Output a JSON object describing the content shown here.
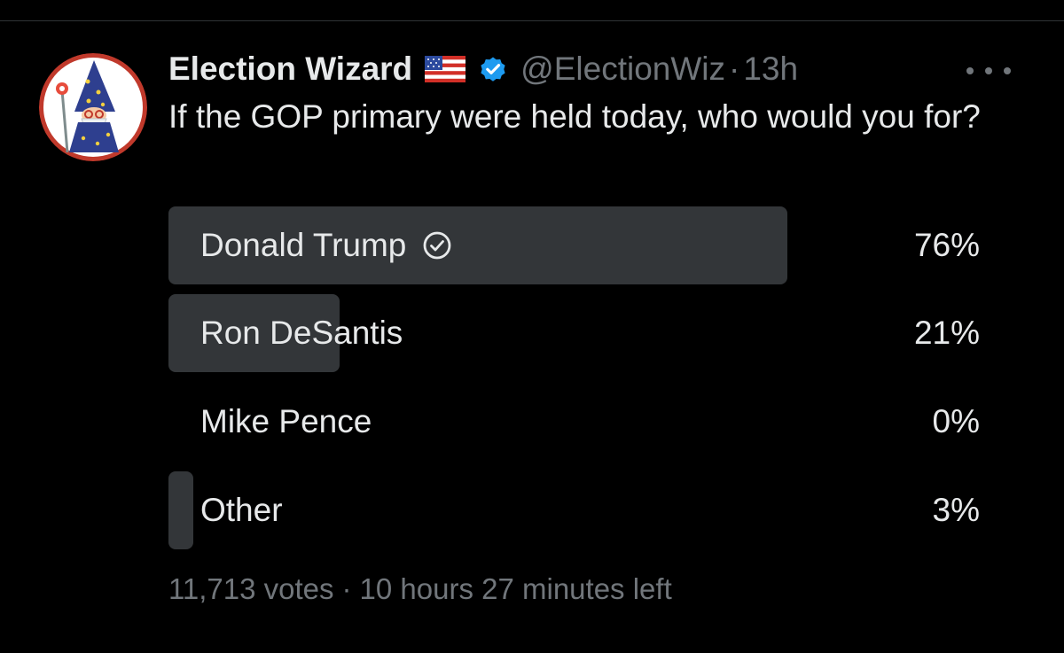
{
  "tweet": {
    "display_name": "Election Wizard",
    "flag_emoji": "us-flag",
    "verified_icon": "verified-badge-icon",
    "handle": "@ElectionWiz",
    "separator": "·",
    "time": "13h",
    "more_icon": "more-horizontal-icon",
    "text": "If the GOP primary were held today, who would you for?"
  },
  "poll": {
    "options": [
      {
        "label": "Donald Trump",
        "percent_text": "76%",
        "percent": 76,
        "winner": true
      },
      {
        "label": "Ron DeSantis",
        "percent_text": "21%",
        "percent": 21,
        "winner": false
      },
      {
        "label": "Mike Pence",
        "percent_text": "0%",
        "percent": 0,
        "winner": false
      },
      {
        "label": "Other",
        "percent_text": "3%",
        "percent": 3,
        "winner": false
      }
    ],
    "votes": "11,713 votes",
    "footer_sep": "·",
    "time_left": "10 hours 27 minutes left"
  },
  "colors": {
    "background": "#000000",
    "text_primary": "#e7e9ea",
    "text_secondary": "#71767b",
    "poll_fill": "#333639",
    "verified_blue": "#1d9bf0",
    "avatar_border": "#c0392b"
  }
}
